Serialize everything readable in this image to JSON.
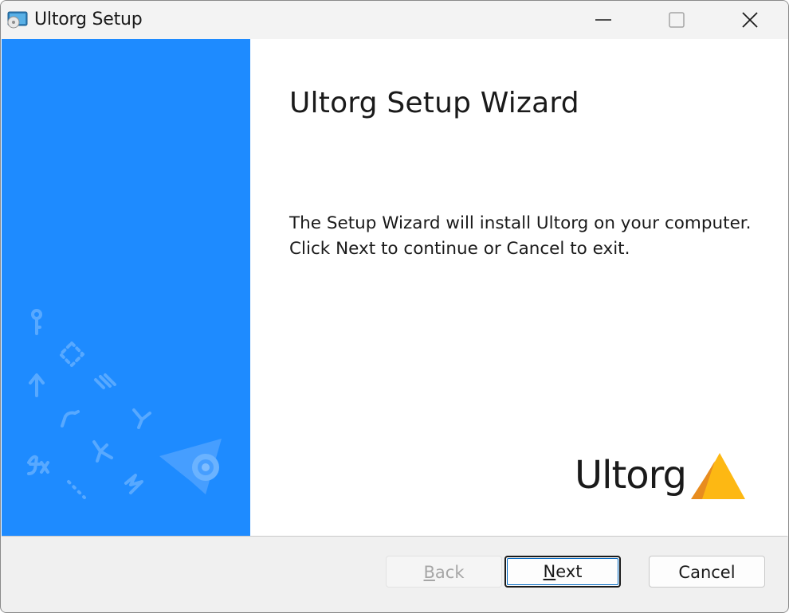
{
  "window": {
    "title": "Ultorg Setup",
    "app_icon": "installer-disc-icon",
    "controls": {
      "minimize_icon": "minimize-icon",
      "maximize_icon": "maximize-icon",
      "close_icon": "close-icon"
    }
  },
  "side_panel": {
    "background_color": "#1e8bff",
    "decoration_icons": [
      "key-icon",
      "dashed-diamond-icon",
      "arrow-up-icon",
      "stripes-icon",
      "curve-icon",
      "branch-icon",
      "join-icon",
      "fx-icon",
      "dots-icon",
      "lightning-icon",
      "paper-plane-icon"
    ]
  },
  "main": {
    "heading": "Ultorg Setup Wizard",
    "description_line1": "The Setup Wizard will install Ultorg on your computer.",
    "description_line2": "Click Next to continue or Cancel to exit.",
    "brand": {
      "wordmark": "Ultorg",
      "mark_colors": [
        "#fdb813",
        "#e88c1e"
      ]
    }
  },
  "footer": {
    "back": {
      "label_first": "B",
      "label_rest": "ack",
      "enabled": false
    },
    "next": {
      "label_first": "N",
      "label_rest": "ext",
      "enabled": true
    },
    "cancel": {
      "label": "Cancel",
      "enabled": true
    }
  }
}
